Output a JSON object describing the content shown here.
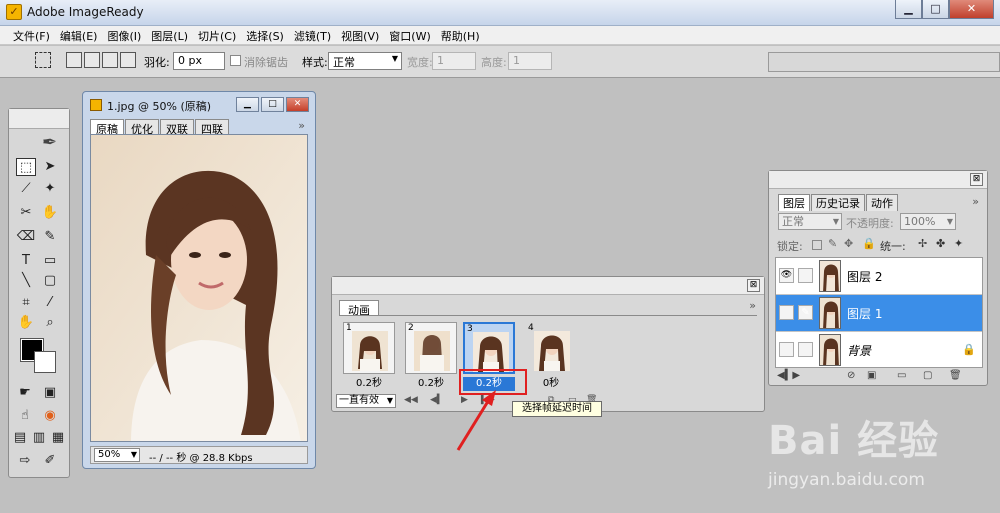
{
  "window": {
    "title": "Adobe ImageReady",
    "min": "▁",
    "max": "□",
    "close": "✕"
  },
  "menu": [
    "文件(F)",
    "编辑(E)",
    "图像(I)",
    "图层(L)",
    "切片(C)",
    "选择(S)",
    "滤镜(T)",
    "视图(V)",
    "窗口(W)",
    "帮助(H)"
  ],
  "options": {
    "feather_label": "羽化:",
    "feather_value": "0 px",
    "antialias_label": "消除锯齿",
    "style_label": "样式:",
    "style_value": "正常",
    "width_label": "宽度:",
    "width_value": "1",
    "height_label": "高度:",
    "height_value": "1"
  },
  "document": {
    "title": "1.jpg @ 50% (原稿)",
    "tabs": [
      "原稿",
      "优化",
      "双联",
      "四联"
    ],
    "more": "»",
    "zoom": "50%",
    "status": "-- / -- 秒 @ 28.8 Kbps"
  },
  "animation": {
    "tab": "动画",
    "more": "»",
    "frames": [
      {
        "num": "1",
        "delay": "0.2秒"
      },
      {
        "num": "2",
        "delay": "0.2秒"
      },
      {
        "num": "3",
        "delay": "0.2秒"
      },
      {
        "num": "4",
        "delay": "0秒"
      }
    ],
    "loop": "一直有效",
    "tooltip": "选择帧延迟时间"
  },
  "layers": {
    "tabs": [
      "图层",
      "历史记录",
      "动作"
    ],
    "more": "»",
    "blend_mode": "正常",
    "opacity_label": "不透明度:",
    "opacity_value": "100%",
    "lock_label": "锁定:",
    "unify_label": "统一:",
    "items": [
      {
        "name": "图层 2",
        "selected": false,
        "eye": "👁"
      },
      {
        "name": "图层 1",
        "selected": true,
        "eye": ""
      },
      {
        "name": "背景",
        "selected": false,
        "eye": ""
      }
    ]
  },
  "watermark": {
    "logo": "Bai 经验",
    "url": "jingyan.baidu.com"
  },
  "colors": {
    "selection_blue": "#3b8ee8",
    "frame_selected": "#2a78d6",
    "highlight_red": "#e02020"
  }
}
